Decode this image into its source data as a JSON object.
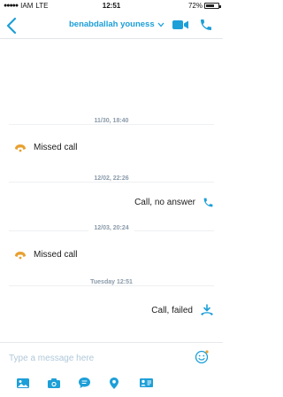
{
  "status_bar": {
    "carrier": "IAM",
    "network": "LTE",
    "time": "12:51",
    "battery": "72%",
    "battery_level": 0.72
  },
  "header": {
    "contact_name": "benabdallah youness"
  },
  "conversation": {
    "events": [
      {
        "date": "11/30, 18:40",
        "text": "Missed call",
        "kind": "missed",
        "side": "left"
      },
      {
        "date": "12/02, 22:26",
        "text": "Call, no answer",
        "kind": "outgoing",
        "side": "right"
      },
      {
        "date": "12/03, 20:24",
        "text": "Missed call",
        "kind": "missed",
        "side": "left"
      },
      {
        "date": "Tuesday 12:51",
        "text": "Call, failed",
        "kind": "failed",
        "side": "right"
      }
    ]
  },
  "compose": {
    "placeholder": "Type a message here"
  },
  "toolbar": {
    "icons": [
      "photos-icon",
      "camera-icon",
      "moji-icon",
      "location-icon",
      "contact-card-icon"
    ]
  },
  "colors": {
    "accent": "#1d9fd8",
    "missed": "#e8a030",
    "date_text": "#8a9aaa"
  }
}
